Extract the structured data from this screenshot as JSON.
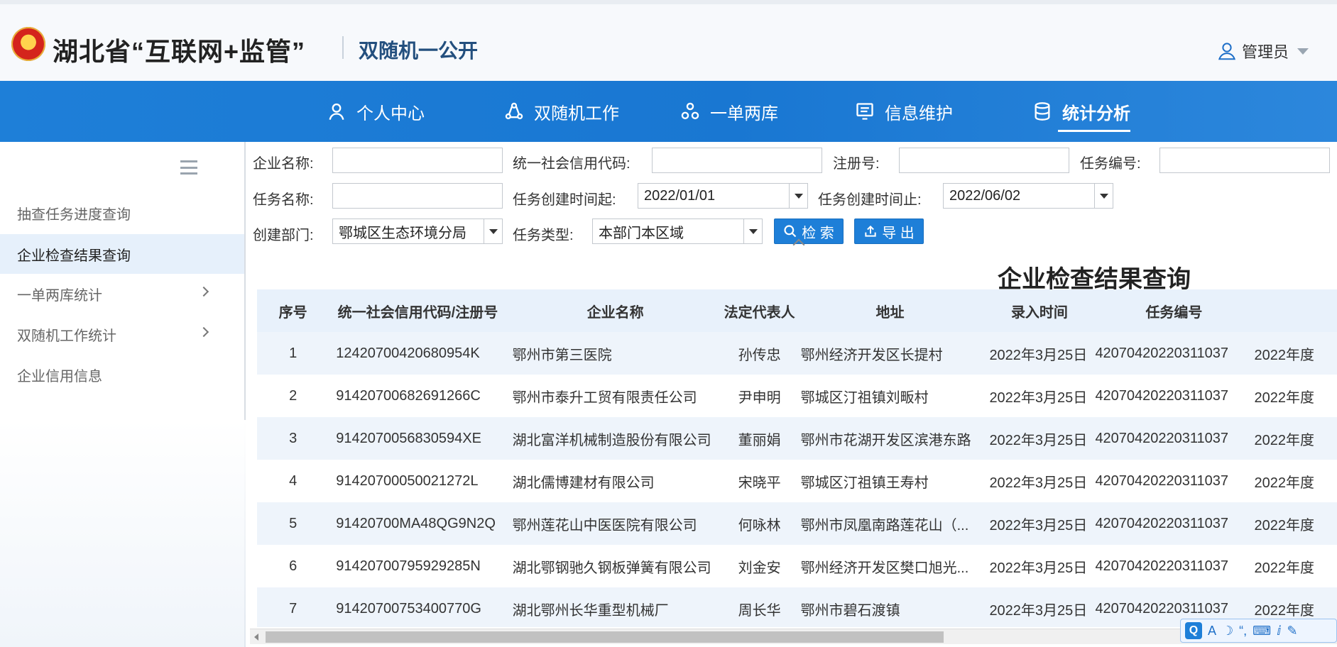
{
  "header": {
    "brand": "湖北省“互联网+监管”",
    "subbrand": "双随机一公开",
    "user": "管理员"
  },
  "nav": {
    "items": [
      {
        "label": "个人中心",
        "icon": "user-icon"
      },
      {
        "label": "双随机工作",
        "icon": "shuffle-icon"
      },
      {
        "label": "一单两库",
        "icon": "cluster-icon"
      },
      {
        "label": "信息维护",
        "icon": "document-icon"
      },
      {
        "label": "统计分析",
        "icon": "database-icon"
      }
    ],
    "active_index": 4
  },
  "sidebar": {
    "items": [
      {
        "label": "抽查任务进度查询"
      },
      {
        "label": "企业检查结果查询"
      },
      {
        "label": "一单两库统计"
      },
      {
        "label": "双随机工作统计"
      },
      {
        "label": "企业信用信息"
      }
    ],
    "active_index": 1
  },
  "filters": {
    "company_name_label": "企业名称:",
    "credit_code_label": "统一社会信用代码:",
    "reg_no_label": "注册号:",
    "task_no_label": "任务编号:",
    "task_name_label": "任务名称:",
    "created_from_label": "任务创建时间起:",
    "created_from_value": "2022/01/01",
    "created_to_label": "任务创建时间止:",
    "created_to_value": "2022/06/02",
    "dept_label": "创建部门:",
    "dept_value": "鄂城区生态环境分局",
    "task_type_label": "任务类型:",
    "task_type_value": "本部门本区域",
    "search_button": "检 索",
    "export_button": "导 出"
  },
  "report": {
    "title": "企业检查结果查询",
    "columns": [
      "序号",
      "统一社会信用代码/注册号",
      "企业名称",
      "法定代表人",
      "地址",
      "录入时间",
      "任务编号",
      ""
    ],
    "rows": [
      {
        "no": "1",
        "code": "12420700420680954K",
        "name": "鄂州市第三医院",
        "rep": "孙传忠",
        "addr": "鄂州经济开发区长提村",
        "time": "2022年3月25日",
        "task": "42070420220311037",
        "plan": "2022年度"
      },
      {
        "no": "2",
        "code": "91420700682691266C",
        "name": "鄂州市泰升工贸有限责任公司",
        "rep": "尹申明",
        "addr": "鄂城区汀祖镇刘畈村",
        "time": "2022年3月25日",
        "task": "42070420220311037",
        "plan": "2022年度"
      },
      {
        "no": "3",
        "code": "9142070056830594XE",
        "name": "湖北富洋机械制造股份有限公司",
        "rep": "董丽娟",
        "addr": "鄂州市花湖开发区滨港东路",
        "time": "2022年3月25日",
        "task": "42070420220311037",
        "plan": "2022年度"
      },
      {
        "no": "4",
        "code": "91420700050021272L",
        "name": "湖北儒博建材有限公司",
        "rep": "宋晓平",
        "addr": "鄂城区汀祖镇王寿村",
        "time": "2022年3月25日",
        "task": "42070420220311037",
        "plan": "2022年度"
      },
      {
        "no": "5",
        "code": "91420700MA48QG9N2Q",
        "name": "鄂州莲花山中医医院有限公司",
        "rep": "何咏林",
        "addr": "鄂州市凤凰南路莲花山（...",
        "time": "2022年3月25日",
        "task": "42070420220311037",
        "plan": "2022年度"
      },
      {
        "no": "6",
        "code": "91420700795929285N",
        "name": "湖北鄂钢驰久钢板弹簧有限公司",
        "rep": "刘金安",
        "addr": "鄂州经济开发区樊口旭光...",
        "time": "2022年3月25日",
        "task": "42070420220311037",
        "plan": "2022年度"
      },
      {
        "no": "7",
        "code": "91420700753400770G",
        "name": "湖北鄂州长华重型机械厂",
        "rep": "周长华",
        "addr": "鄂州市碧石渡镇",
        "time": "2022年3月25日",
        "task": "42070420220311037",
        "plan": "2022年度"
      }
    ]
  },
  "ime": {
    "items": [
      "Q",
      "A",
      "☽",
      "“,",
      "⌨",
      "ⅈ",
      "✎"
    ]
  }
}
